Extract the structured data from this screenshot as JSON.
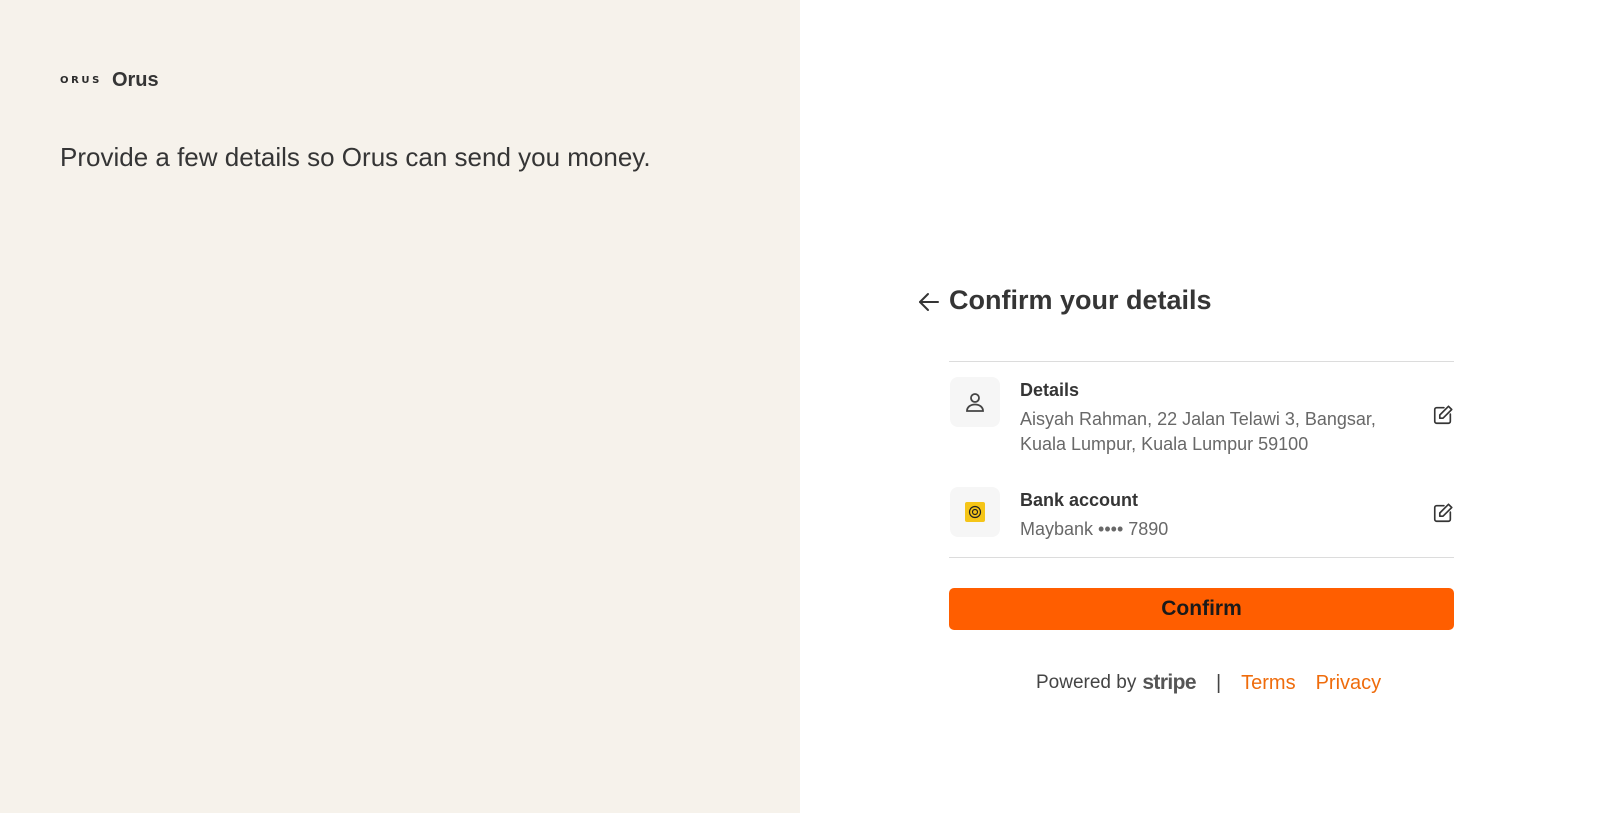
{
  "brand": {
    "mark": "ORUS",
    "name": "Orus"
  },
  "left": {
    "tagline": "Provide a few details so Orus can send you money."
  },
  "confirm": {
    "title": "Confirm your details",
    "details": {
      "label": "Details",
      "line1": "Aisyah Rahman, 22 Jalan Telawi 3, Bangsar,",
      "line2": "Kuala Lumpur, Kuala Lumpur 59100",
      "icon": "person-icon"
    },
    "bank": {
      "label": "Bank account",
      "value": "Maybank •••• 7890",
      "icon": "maybank-logo"
    },
    "button_label": "Confirm"
  },
  "footer": {
    "powered_by": "Powered by",
    "stripe": "stripe",
    "separator": "|",
    "terms": "Terms",
    "privacy": "Privacy"
  },
  "colors": {
    "accent": "#ff5e00",
    "link": "#ef6c0c",
    "left_background": "#f6f2eb"
  }
}
